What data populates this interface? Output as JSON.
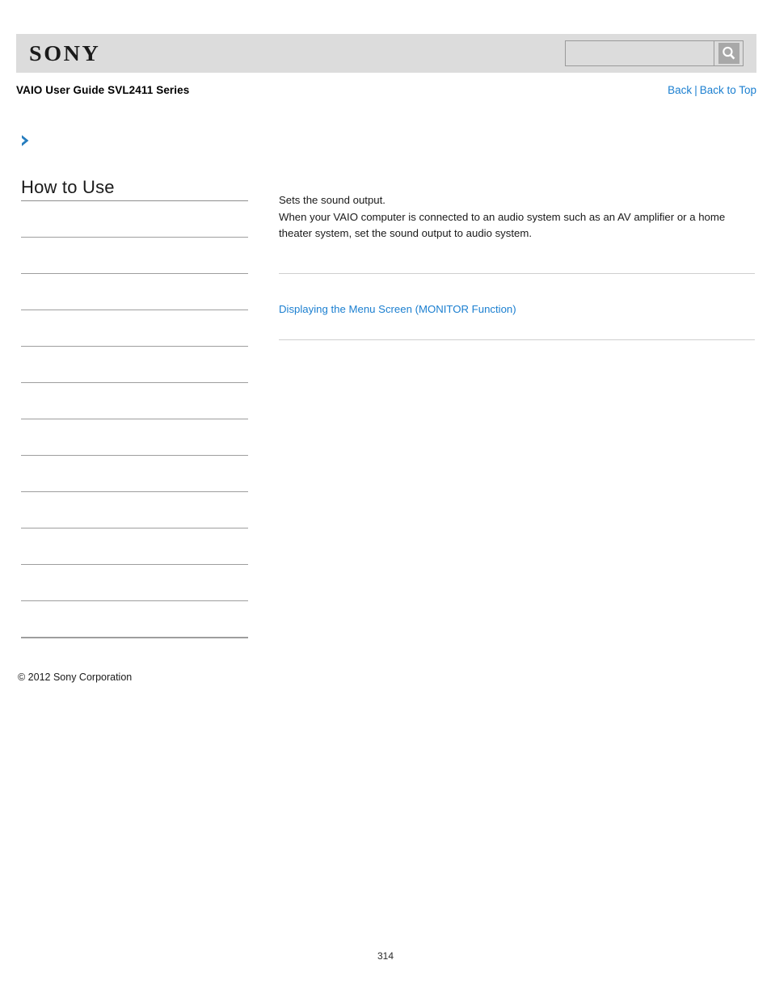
{
  "header": {
    "logo_text": "SONY",
    "search": {
      "value": "",
      "placeholder": "",
      "icon": "search-icon",
      "button_label": ""
    }
  },
  "guide": {
    "title": "VAIO User Guide SVL2411 Series",
    "nav": {
      "back_label": "Back",
      "separator": "|",
      "back_to_top_label": "Back to Top"
    }
  },
  "breadcrumb": {
    "icon": "chevron-right-icon",
    "text": ""
  },
  "sidebar": {
    "heading": "How to Use",
    "items": [
      {
        "label": ""
      },
      {
        "label": ""
      },
      {
        "label": ""
      },
      {
        "label": ""
      },
      {
        "label": ""
      },
      {
        "label": ""
      },
      {
        "label": ""
      },
      {
        "label": ""
      },
      {
        "label": ""
      },
      {
        "label": ""
      },
      {
        "label": ""
      },
      {
        "label": ""
      }
    ]
  },
  "content": {
    "paragraphs": [
      "Sets the sound output.",
      "When your VAIO computer is connected to an audio system such as an AV amplifier or a home theater system, set the sound output to audio system."
    ],
    "related_link": "Displaying the Menu Screen (MONITOR Function)"
  },
  "footer": {
    "copyright": "© 2012 Sony Corporation",
    "page_number": "314"
  },
  "colors": {
    "link_blue": "#1b7fd0",
    "header_gray": "#dcdcdc",
    "rule_gray": "#9e9e9e",
    "content_rule_gray": "#cfcfcf"
  }
}
